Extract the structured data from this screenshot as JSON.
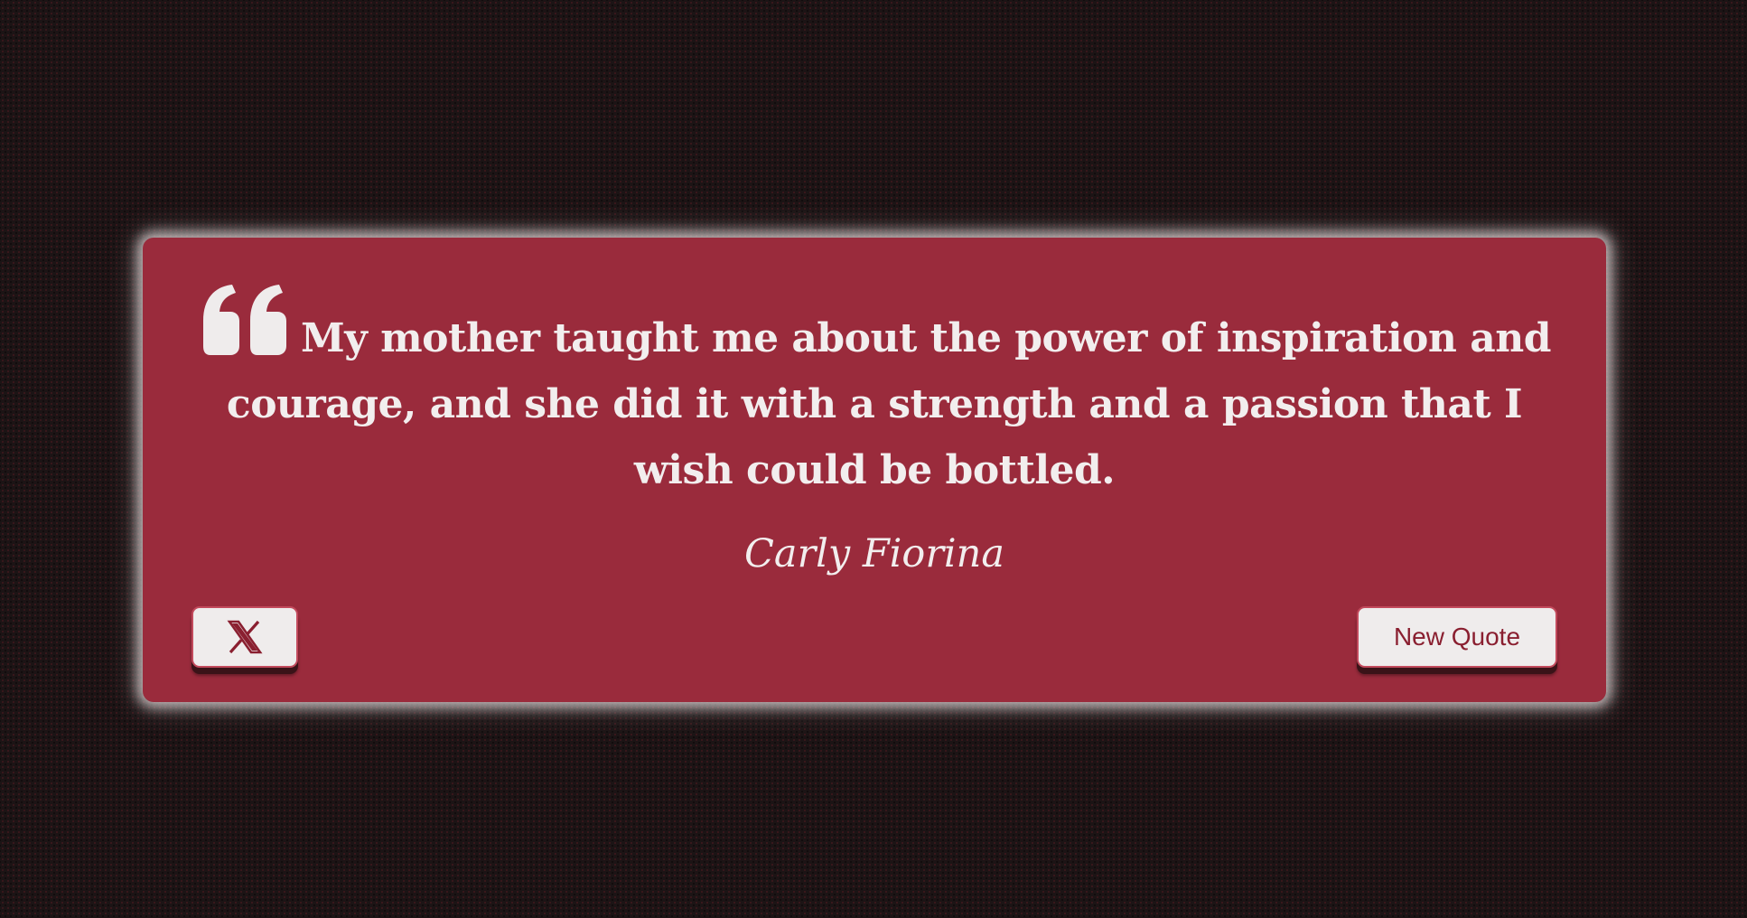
{
  "quote": {
    "text": "My mother taught me about the power of inspiration and courage, and she did it with a strength and a passion that I wish could be bottled.",
    "author": "Carly Fiorina"
  },
  "buttons": {
    "tweet_icon": "x-logo-icon",
    "new_quote_label": "New Quote"
  },
  "colors": {
    "background": "#1c1415",
    "card": "#9a2b3c",
    "text": "#f2eeee",
    "button_bg": "#efecec",
    "button_text": "#8a1f30"
  }
}
